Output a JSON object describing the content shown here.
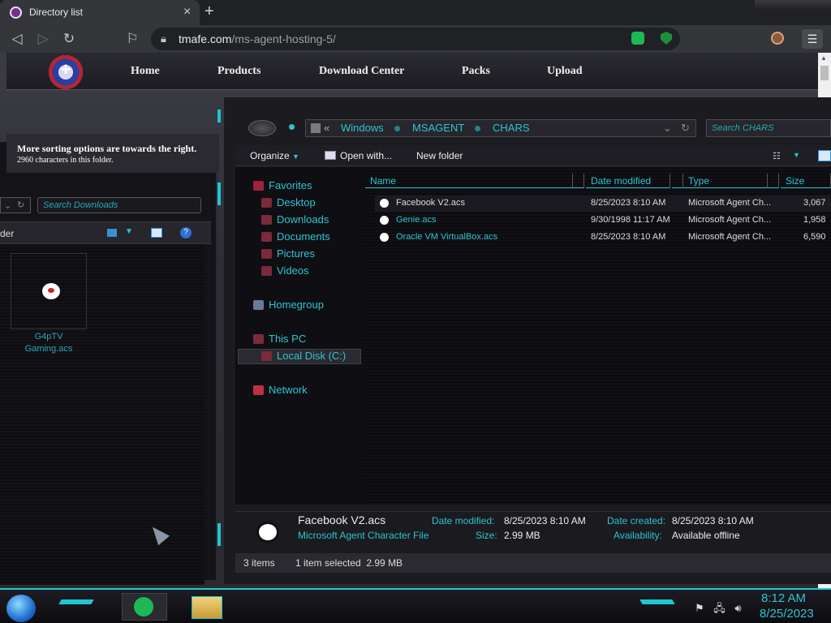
{
  "browser": {
    "tab_title": "Directory list",
    "new_tab": "+",
    "close_tab": "×",
    "url_host": "tmafe.com",
    "url_path": "/ms-agent-hosting-5/"
  },
  "site": {
    "logo_glyph": "+",
    "nav": [
      "Home",
      "Products",
      "Download Center",
      "Packs",
      "Upload"
    ]
  },
  "hint": {
    "line1": "More sorting options are towards the right.",
    "line2": "2960 characters in this folder."
  },
  "left_window": {
    "search_placeholder": "Search Downloads",
    "toolbar_label": "der",
    "file_name": "G4pTV Gaming.acs"
  },
  "main_window": {
    "breadcrumbs": [
      "Windows",
      "MSAGENT",
      "CHARS"
    ],
    "breadcrumb_prefix": "«",
    "search_placeholder": "Search CHARS",
    "commands": {
      "organize": "Organize",
      "open_with": "Open with...",
      "new_folder": "New folder"
    },
    "nav": {
      "favorites": "Favorites",
      "desktop": "Desktop",
      "downloads": "Downloads",
      "documents": "Documents",
      "pictures": "Pictures",
      "videos": "Videos",
      "homegroup": "Homegroup",
      "this_pc": "This PC",
      "local_disk": "Local Disk (C:)",
      "network": "Network"
    },
    "columns": [
      "Name",
      "Date modified",
      "Type",
      "Size"
    ],
    "files": [
      {
        "name": "Facebook V2.acs",
        "date": "8/25/2023 8:10 AM",
        "type": "Microsoft Agent Ch...",
        "size": "3,067"
      },
      {
        "name": "Genie.acs",
        "date": "9/30/1998 11:17 AM",
        "type": "Microsoft Agent Ch...",
        "size": "1,958"
      },
      {
        "name": "Oracle VM VirtualBox.acs",
        "date": "8/25/2023 8:10 AM",
        "type": "Microsoft Agent Ch...",
        "size": "6,590"
      }
    ],
    "details": {
      "file_name": "Facebook V2.acs",
      "file_type": "Microsoft Agent Character File",
      "date_modified_label": "Date modified:",
      "date_modified": "8/25/2023 8:10 AM",
      "size_label": "Size:",
      "size": "2.99 MB",
      "date_created_label": "Date created:",
      "date_created": "8/25/2023 8:10 AM",
      "availability_label": "Availability:",
      "availability": "Available offline"
    },
    "status": {
      "items": "3 items",
      "selected": "1 item selected  2.99 MB"
    }
  },
  "taskbar": {
    "time": "8:12 AM",
    "date": "8/25/2023"
  },
  "colors": {
    "accent": "#20c6d3",
    "text_cyan": "#2ec4cf"
  }
}
